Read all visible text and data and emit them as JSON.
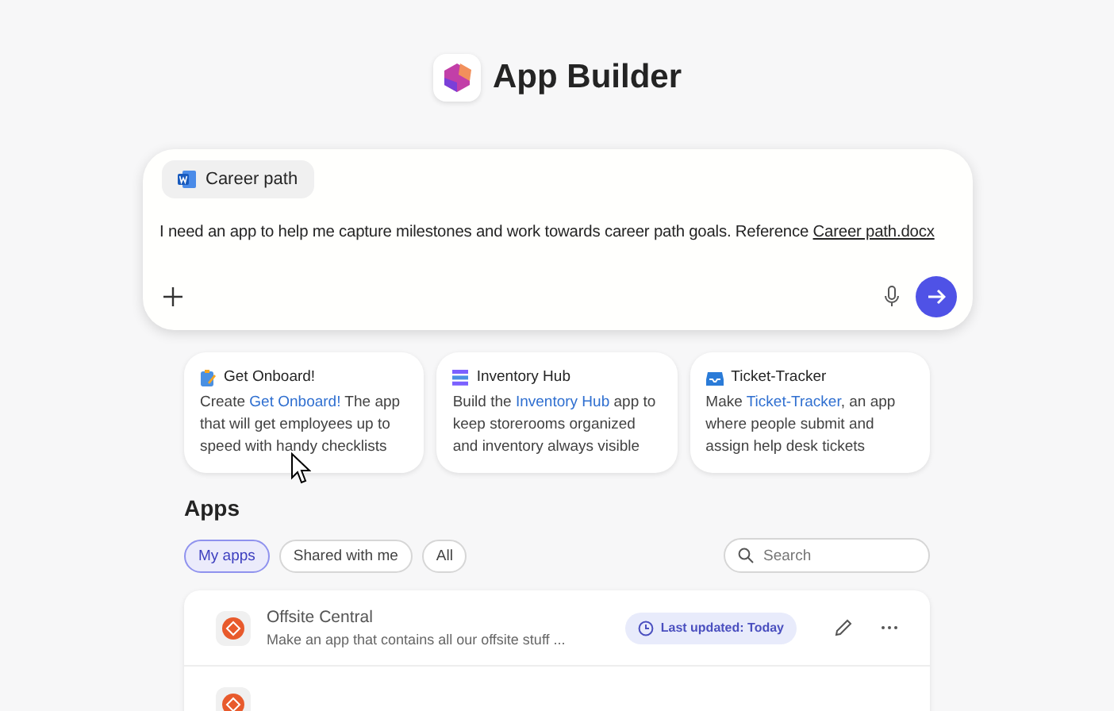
{
  "header": {
    "title": "App Builder"
  },
  "prompt": {
    "attachment": "Career path",
    "text": "I need an app to help me capture milestones and work towards career path goals. Reference ",
    "link": "Career path.docx"
  },
  "suggestions": [
    {
      "title": "Get Onboard!",
      "before": "Create ",
      "highlight": "Get Onboard!",
      "after": " The app that will get employees up to speed with handy checklists",
      "kind": "clipboard"
    },
    {
      "title": "Inventory Hub",
      "before": "Build the ",
      "highlight": "Inventory Hub",
      "after": " app to keep storerooms organized and inventory always visible",
      "kind": "stack"
    },
    {
      "title": "Ticket-Tracker",
      "before": "Make ",
      "highlight": "Ticket-Tracker",
      "after": ", an app where people submit and assign help desk tickets",
      "kind": "inbox"
    }
  ],
  "apps": {
    "heading": "Apps",
    "filters": [
      {
        "label": "My apps",
        "selected": true
      },
      {
        "label": "Shared with me",
        "selected": false
      },
      {
        "label": "All",
        "selected": false
      }
    ],
    "search": {
      "placeholder": "Search"
    },
    "rows": [
      {
        "name": "Offsite Central",
        "description": "Make an app that contains all our offsite stuff ...",
        "status": "Last updated: Today"
      },
      {}
    ]
  }
}
